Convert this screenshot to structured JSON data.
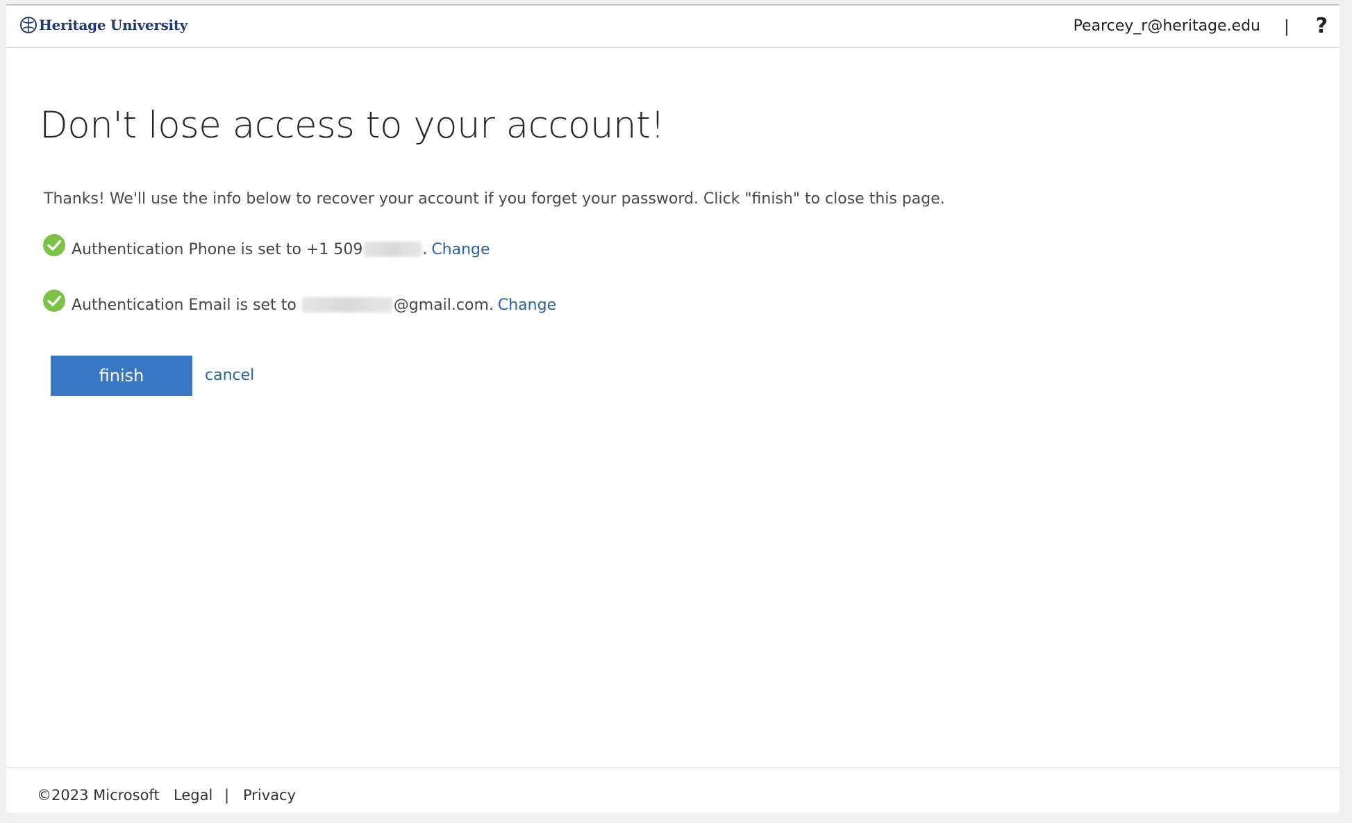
{
  "header": {
    "brand": "Heritage University",
    "user_email": "Pearcey_r@heritage.edu",
    "separator": "|",
    "help_glyph": "?",
    "help_icon": "question-mark-icon"
  },
  "main": {
    "title": "Don't lose access to your account!",
    "intro": "Thanks! We'll use the info below to recover your account if you forget your password. Click \"finish\" to close this page.",
    "phone": {
      "prefix": "Authentication Phone is set to +1 509",
      "suffix": ".",
      "change_label": "Change",
      "icon": "green-check-icon"
    },
    "email": {
      "prefix": "Authentication Email is set to",
      "suffix": "@gmail.com.",
      "change_label": "Change",
      "icon": "green-check-icon"
    },
    "finish_label": "finish",
    "cancel_label": "cancel"
  },
  "footer": {
    "copyright": "©2023 Microsoft",
    "legal": "Legal",
    "separator": "|",
    "privacy": "Privacy"
  },
  "colors": {
    "accent": "#3a78c5",
    "link": "#2a62a8",
    "success": "#7dc242",
    "brand": "#1f3b73"
  }
}
